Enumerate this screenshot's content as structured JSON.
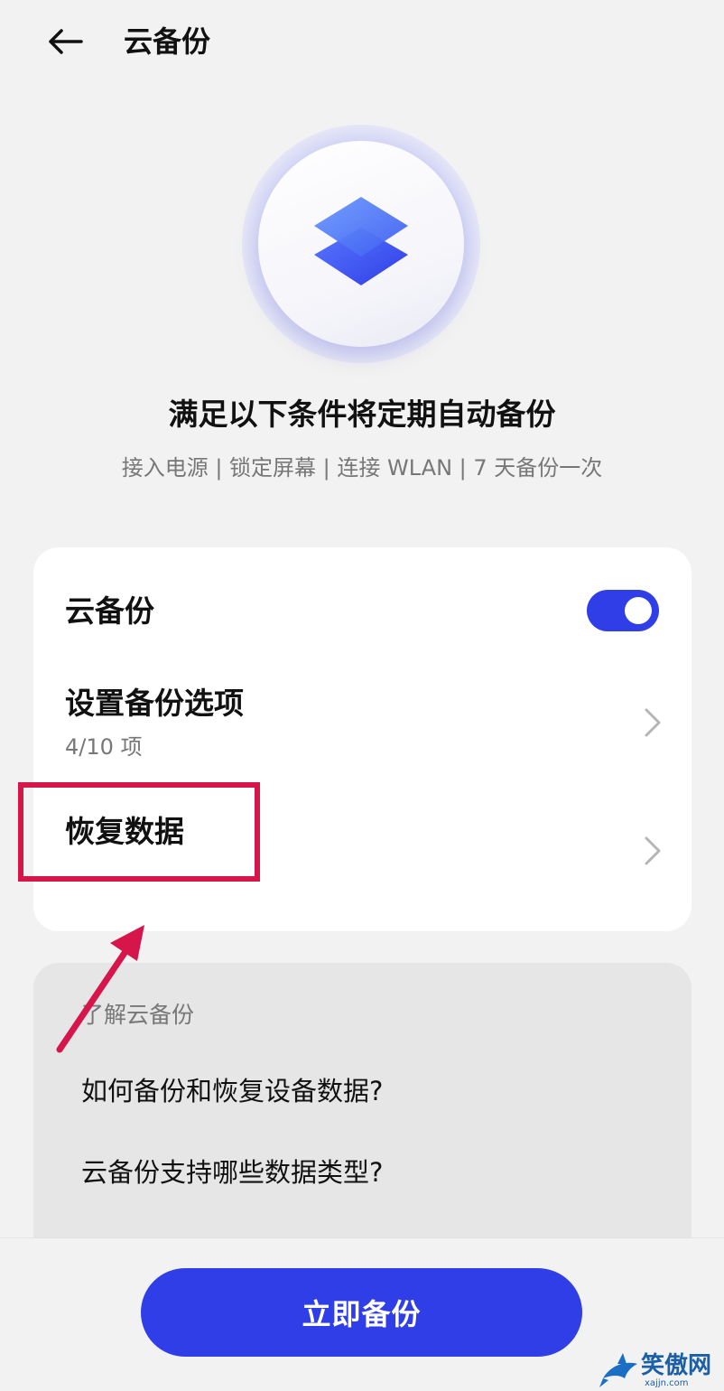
{
  "header": {
    "back_icon": "arrow-left-icon",
    "title": "云备份"
  },
  "hero": {
    "icon": "layers-icon",
    "heading": "满足以下条件将定期自动备份",
    "conditions": "接入电源 | 锁定屏幕 | 连接 WLAN | 7 天备份一次"
  },
  "settings": {
    "cloud_backup": {
      "label": "云备份",
      "toggle_on": true
    },
    "backup_options": {
      "label": "设置备份选项",
      "summary": "4/10 项"
    },
    "restore": {
      "label": "恢复数据"
    }
  },
  "faq": {
    "label": "了解云备份",
    "items": [
      "如何备份和恢复设备数据?",
      "云备份支持哪些数据类型?"
    ]
  },
  "footer": {
    "primary_button": "立即备份"
  },
  "watermark": {
    "text": "笑傲网",
    "sub": "xajjn.com"
  },
  "colors": {
    "accent": "#2f3ee6",
    "highlight": "#d6154b",
    "background": "#f2f2f2"
  }
}
